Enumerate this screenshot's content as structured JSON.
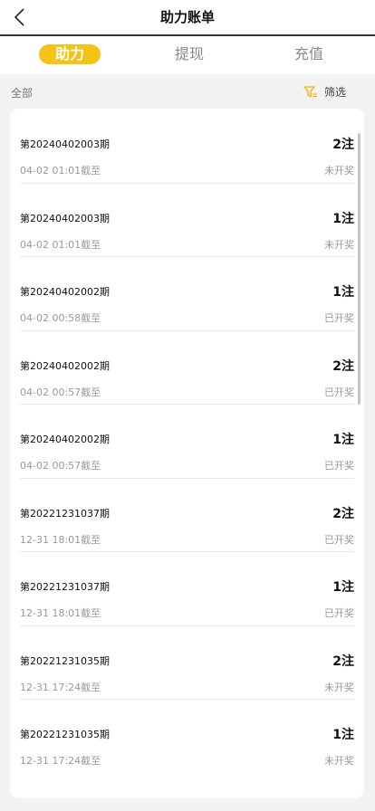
{
  "header": {
    "title": "助力账单"
  },
  "tabs": [
    {
      "label": "助力"
    },
    {
      "label": "提现"
    },
    {
      "label": "充值"
    }
  ],
  "filter": {
    "all_label": "全部",
    "filter_label": "筛选"
  },
  "records": [
    {
      "period": "第20240402003期",
      "time": "04-02 01:01截至",
      "count": "2注",
      "status": "未开奖"
    },
    {
      "period": "第20240402003期",
      "time": "04-02 01:01截至",
      "count": "1注",
      "status": "未开奖"
    },
    {
      "period": "第20240402002期",
      "time": "04-02 00:58截至",
      "count": "1注",
      "status": "已开奖"
    },
    {
      "period": "第20240402002期",
      "time": "04-02 00:57截至",
      "count": "2注",
      "status": "已开奖"
    },
    {
      "period": "第20240402002期",
      "time": "04-02 00:57截至",
      "count": "1注",
      "status": "已开奖"
    },
    {
      "period": "第20221231037期",
      "time": "12-31 18:01截至",
      "count": "2注",
      "status": "已开奖"
    },
    {
      "period": "第20221231037期",
      "time": "12-31 18:01截至",
      "count": "1注",
      "status": "已开奖"
    },
    {
      "period": "第20221231035期",
      "time": "12-31 17:24截至",
      "count": "2注",
      "status": "未开奖"
    },
    {
      "period": "第20221231035期",
      "time": "12-31 17:24截至",
      "count": "1注",
      "status": "未开奖"
    }
  ],
  "colors": {
    "accent": "#f5c316",
    "filter_icon": "#f0b400"
  }
}
